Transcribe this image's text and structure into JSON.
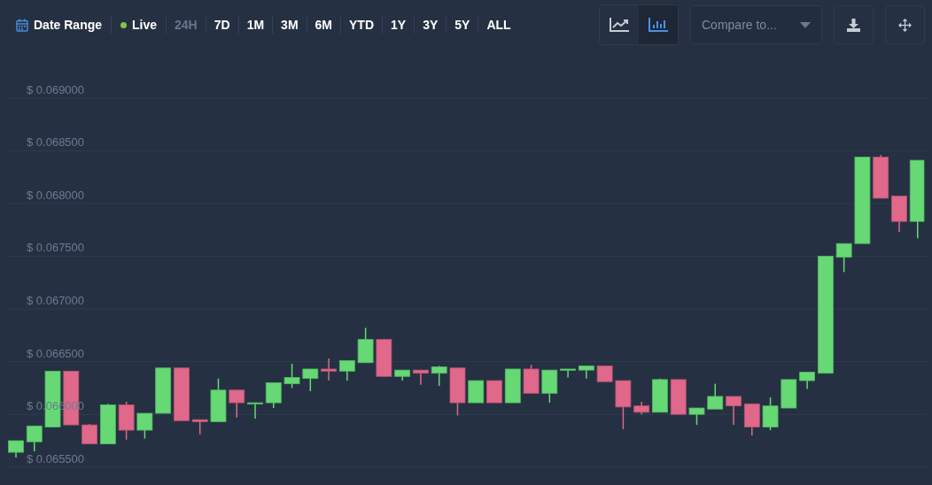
{
  "toolbar": {
    "date_range": {
      "label": "Date Range"
    },
    "live": {
      "label": "Live",
      "on": true
    },
    "ranges": [
      {
        "label": "24H",
        "selected": true
      },
      {
        "label": "7D",
        "selected": false
      },
      {
        "label": "1M",
        "selected": false
      },
      {
        "label": "3M",
        "selected": false
      },
      {
        "label": "6M",
        "selected": false
      },
      {
        "label": "YTD",
        "selected": false
      },
      {
        "label": "1Y",
        "selected": false
      },
      {
        "label": "3Y",
        "selected": false
      },
      {
        "label": "5Y",
        "selected": false
      },
      {
        "label": "ALL",
        "selected": false
      }
    ],
    "chart_types": [
      {
        "kind": "line",
        "selected": false
      },
      {
        "kind": "candles",
        "selected": true
      }
    ],
    "compare": {
      "placeholder": "Compare to..."
    }
  },
  "chart": {
    "chart_data": {
      "type": "candlestick",
      "ylim": [
        0.06533,
        0.06993
      ],
      "grid": true,
      "yticks": [
        {
          "value": 0.0655,
          "label": "$ 0.065500"
        },
        {
          "value": 0.066,
          "label": "$ 0.066000"
        },
        {
          "value": 0.0665,
          "label": "$ 0.066500"
        },
        {
          "value": 0.067,
          "label": "$ 0.067000"
        },
        {
          "value": 0.0675,
          "label": "$ 0.067500"
        },
        {
          "value": 0.068,
          "label": "$ 0.068000"
        },
        {
          "value": 0.0685,
          "label": "$ 0.068500"
        },
        {
          "value": 0.069,
          "label": "$ 0.069000"
        }
      ],
      "ohlc": [
        [
          0.06564,
          0.06575,
          0.06559,
          0.06575
        ],
        [
          0.06574,
          0.06589,
          0.06565,
          0.06589
        ],
        [
          0.06588,
          0.06641,
          0.06588,
          0.06641
        ],
        [
          0.06641,
          0.06641,
          0.0659,
          0.0659
        ],
        [
          0.0659,
          0.06591,
          0.06572,
          0.06572
        ],
        [
          0.06572,
          0.0661,
          0.06572,
          0.06609
        ],
        [
          0.06609,
          0.06612,
          0.06576,
          0.06585
        ],
        [
          0.06585,
          0.06601,
          0.06577,
          0.06601
        ],
        [
          0.06601,
          0.06644,
          0.06601,
          0.06644
        ],
        [
          0.06644,
          0.06644,
          0.06594,
          0.06594
        ],
        [
          0.06595,
          0.06595,
          0.06581,
          0.06593
        ],
        [
          0.06593,
          0.06634,
          0.06593,
          0.06623
        ],
        [
          0.06623,
          0.06623,
          0.06597,
          0.06611
        ],
        [
          0.06611,
          0.06611,
          0.06596,
          0.06611
        ],
        [
          0.06611,
          0.0663,
          0.06606,
          0.0663
        ],
        [
          0.06629,
          0.06648,
          0.06625,
          0.06635
        ],
        [
          0.06634,
          0.06643,
          0.06622,
          0.06643
        ],
        [
          0.06643,
          0.06653,
          0.06632,
          0.06641
        ],
        [
          0.06641,
          0.06651,
          0.06632,
          0.06651
        ],
        [
          0.06649,
          0.06682,
          0.06649,
          0.06671
        ],
        [
          0.06671,
          0.06671,
          0.06636,
          0.06636
        ],
        [
          0.06636,
          0.06642,
          0.06632,
          0.06642
        ],
        [
          0.06642,
          0.06642,
          0.06628,
          0.06639
        ],
        [
          0.06639,
          0.06646,
          0.06627,
          0.06645
        ],
        [
          0.06644,
          0.06644,
          0.06599,
          0.06611
        ],
        [
          0.06611,
          0.06632,
          0.06611,
          0.06632
        ],
        [
          0.06632,
          0.06632,
          0.06611,
          0.06611
        ],
        [
          0.06611,
          0.06643,
          0.06611,
          0.06643
        ],
        [
          0.06643,
          0.06647,
          0.0662,
          0.0662
        ],
        [
          0.0662,
          0.06642,
          0.06611,
          0.06642
        ],
        [
          0.06642,
          0.06643,
          0.06635,
          0.06643
        ],
        [
          0.06642,
          0.06646,
          0.06634,
          0.06646
        ],
        [
          0.06646,
          0.06646,
          0.06631,
          0.06631
        ],
        [
          0.06632,
          0.06632,
          0.06586,
          0.06607
        ],
        [
          0.06608,
          0.06612,
          0.066,
          0.06602
        ],
        [
          0.06602,
          0.06634,
          0.06602,
          0.06633
        ],
        [
          0.06633,
          0.06633,
          0.066,
          0.066
        ],
        [
          0.066,
          0.06606,
          0.0659,
          0.06606
        ],
        [
          0.06605,
          0.06629,
          0.06605,
          0.06617
        ],
        [
          0.06617,
          0.06617,
          0.0659,
          0.06608
        ],
        [
          0.0661,
          0.0661,
          0.0658,
          0.06588
        ],
        [
          0.06588,
          0.06616,
          0.06585,
          0.06608
        ],
        [
          0.06606,
          0.06633,
          0.06606,
          0.06633
        ],
        [
          0.06632,
          0.0664,
          0.06624,
          0.0664
        ],
        [
          0.06639,
          0.0675,
          0.06639,
          0.0675
        ],
        [
          0.06749,
          0.06762,
          0.06735,
          0.06762
        ],
        [
          0.06762,
          0.06844,
          0.06762,
          0.06844
        ],
        [
          0.06844,
          0.06846,
          0.06805,
          0.06805
        ],
        [
          0.06807,
          0.06807,
          0.06773,
          0.06783
        ],
        [
          0.06783,
          0.06841,
          0.06767,
          0.06841
        ]
      ]
    }
  }
}
